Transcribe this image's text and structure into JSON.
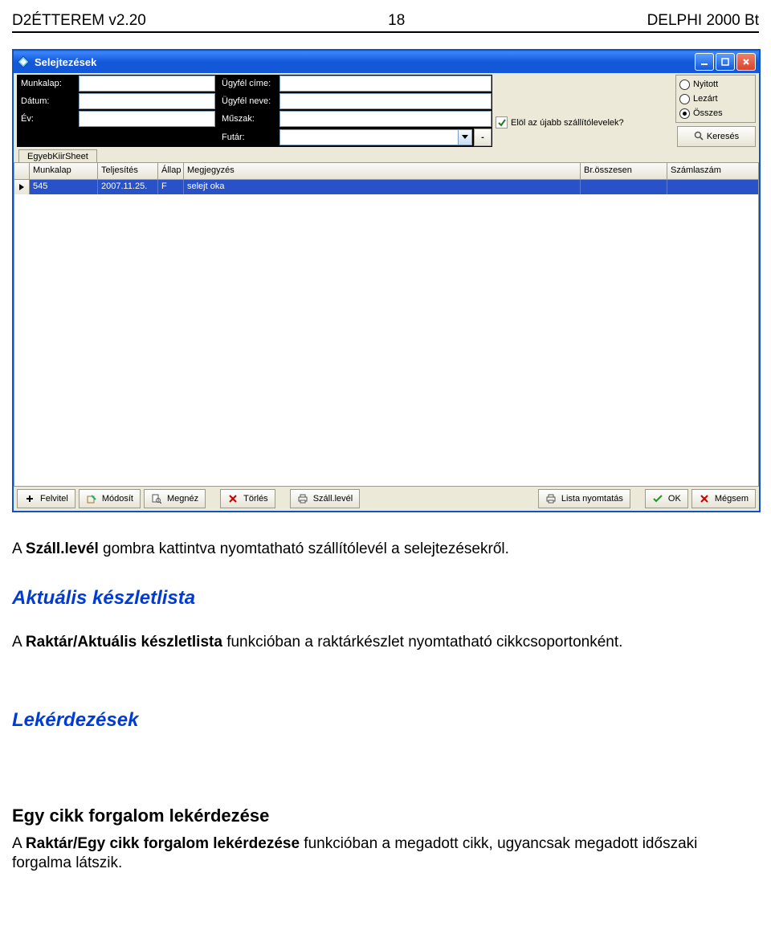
{
  "doc_header": {
    "left": "D2ÉTTEREM v2.20",
    "center": "18",
    "right": "DELPHI 2000 Bt"
  },
  "window": {
    "title": "Selejtezések",
    "fields": {
      "munkalap_lbl": "Munkalap:",
      "munkalap_val": "",
      "datum_lbl": "Dátum:",
      "datum_val": "",
      "ev_lbl": "Év:",
      "ev_val": "",
      "ugyfel_cime_lbl": "Ügyfél címe:",
      "ugyfel_cime_val": "",
      "ugyfel_neve_lbl": "Ügyfél neve:",
      "ugyfel_neve_val": "",
      "muszak_lbl": "Műszak:",
      "muszak_val": "",
      "futar_lbl": "Futár:",
      "futar_val": ""
    },
    "ellipsis": "-",
    "checkbox": {
      "checked": true,
      "label": "Elöl az újabb szállítólevelek?"
    },
    "radios": [
      {
        "label": "Nyitott",
        "selected": false
      },
      {
        "label": "Lezárt",
        "selected": false
      },
      {
        "label": "Összes",
        "selected": true
      }
    ],
    "search_btn": "Keresés",
    "tab": "EgyebKiirSheet",
    "columns": [
      "Munkalap",
      "Teljesítés",
      "Állap",
      "Megjegyzés",
      "Br.összesen",
      "Számlaszám"
    ],
    "row": {
      "munkalap": "545",
      "teljesites": "2007.11.25.",
      "allap": "F",
      "megjegyzes": "selejt oka",
      "br": "",
      "szam": ""
    },
    "toolbar": {
      "felvitel": "Felvitel",
      "modosit": "Módosít",
      "megnez": "Megnéz",
      "torles": "Törlés",
      "szalllevel": "Száll.levél",
      "listanyom": "Lista nyomtatás",
      "ok": "OK",
      "megsem": "Mégsem"
    }
  },
  "body": {
    "p1_prefix": "A ",
    "p1_strong": "Száll.levél",
    "p1_rest": " gombra kattintva nyomtatható szállítólevél a selejtezésekről.",
    "sec1_title": "Aktuális készletlista",
    "sec1_p_prefix": "A ",
    "sec1_p_strong": "Raktár/Aktuális készletlista",
    "sec1_p_rest": " funkcióban a raktárkészlet nyomtatható cikkcsoportonként.",
    "sec2_title": "Lekérdezések",
    "sub1": "Egy cikk forgalom lekérdezése",
    "sub1_p_prefix": "A ",
    "sub1_p_strong": "Raktár/Egy cikk forgalom lekérdezése",
    "sub1_p_rest": " funkcióban a megadott cikk, ugyancsak megadott időszaki forgalma látszik."
  }
}
